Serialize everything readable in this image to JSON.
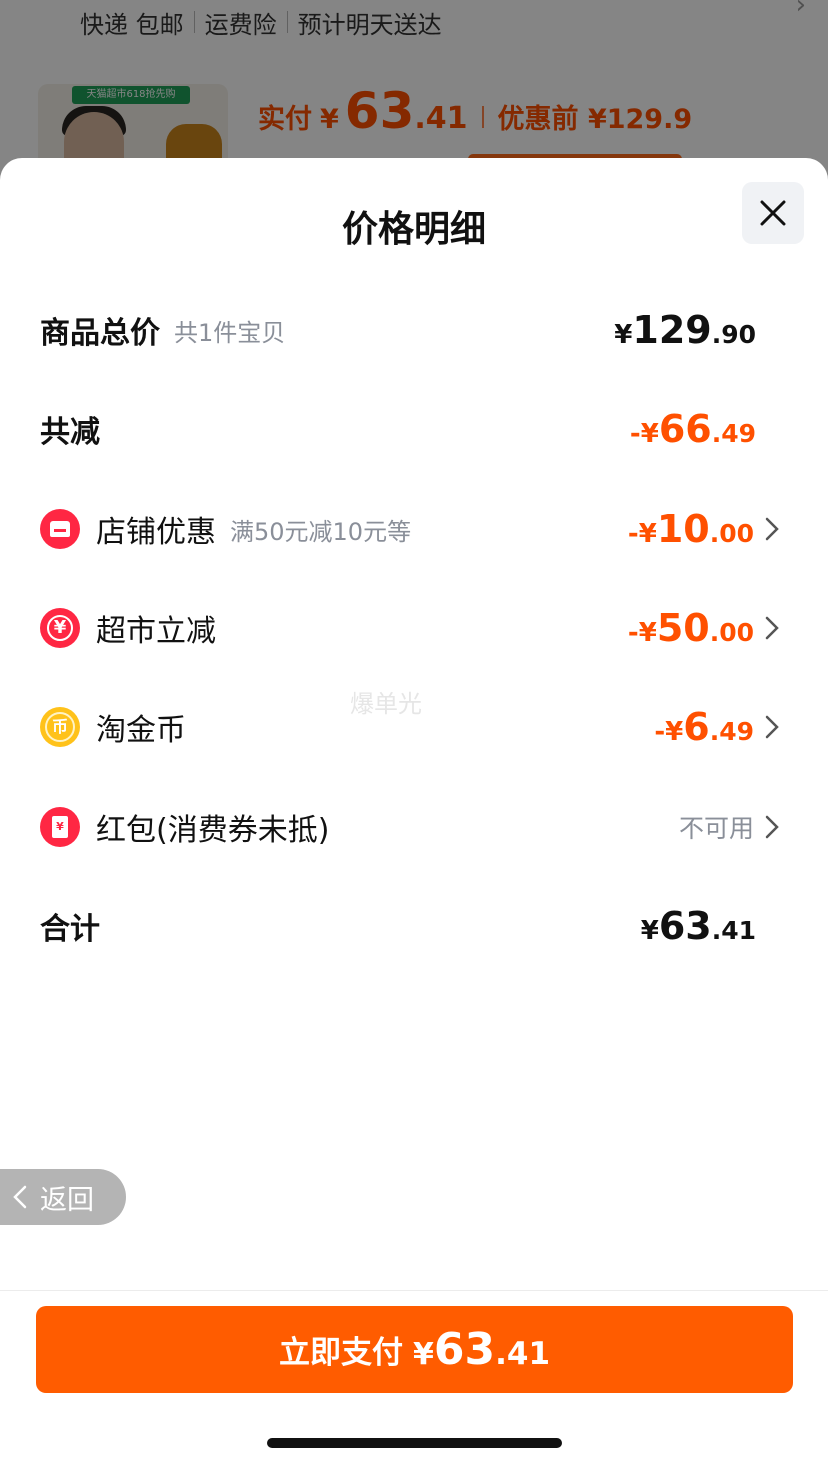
{
  "background": {
    "shipping": [
      "快递 包邮",
      "运费险",
      "预计明天送达"
    ],
    "thumb_banner": "天猫超市618抢先购",
    "paid_label": "实付",
    "paid_symbol": "¥",
    "paid_int": "63",
    "paid_dec": ".41",
    "original_label": "优惠前 ¥129.9"
  },
  "sheet": {
    "title": "价格明细",
    "rows": {
      "subtotal": {
        "label": "商品总价",
        "sub": "共1件宝贝",
        "sym": "¥",
        "int": "129",
        "dec": ".90"
      },
      "discount_total": {
        "label": "共减",
        "sym": "-¥",
        "int": "66",
        "dec": ".49"
      },
      "shop_discount": {
        "label": "店铺优惠",
        "sub": "满50元减10元等",
        "sym": "-¥",
        "int": "10",
        "dec": ".00",
        "icon": "shop-icon"
      },
      "market_discount": {
        "label": "超市立减",
        "sym": "-¥",
        "int": "50",
        "dec": ".00",
        "icon": "yuan-coin-icon",
        "icon_glyph": "¥"
      },
      "gold_coin": {
        "label": "淘金币",
        "sym": "-¥",
        "int": "6",
        "dec": ".49",
        "icon": "gold-coin-icon",
        "icon_glyph": "币"
      },
      "red_packet": {
        "label": "红包(消费券未抵)",
        "status": "不可用",
        "icon": "red-packet-icon",
        "icon_glyph": "¥"
      },
      "total": {
        "label": "合计",
        "sym": "¥",
        "int": "63",
        "dec": ".41"
      }
    },
    "watermark": "爆单光",
    "back_label": "返回",
    "pay": {
      "label": "立即支付",
      "sym": "¥",
      "int": "63",
      "dec": ".41"
    }
  },
  "colors": {
    "accent": "#ff5000",
    "pay_button": "#ff5c00",
    "icon_red": "#ff2743",
    "icon_gold": "#ffc21a",
    "muted_text": "#8a8f99"
  }
}
